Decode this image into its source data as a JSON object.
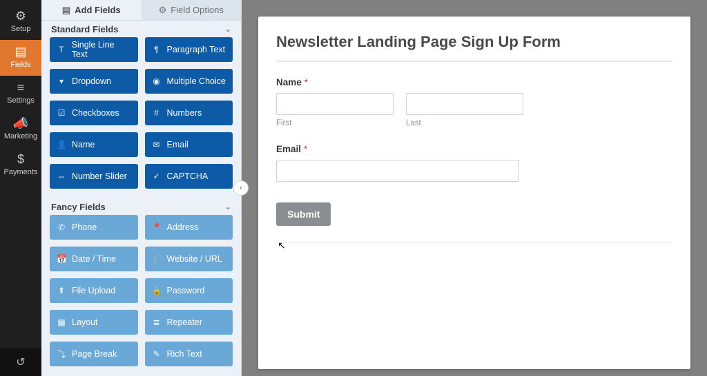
{
  "nav": {
    "items": [
      {
        "label": "Setup",
        "icon": "⚙"
      },
      {
        "label": "Fields",
        "icon": "▤"
      },
      {
        "label": "Settings",
        "icon": "≡"
      },
      {
        "label": "Marketing",
        "icon": "📣"
      },
      {
        "label": "Payments",
        "icon": "$"
      }
    ],
    "history_icon": "↺"
  },
  "panel": {
    "tabs": {
      "add": {
        "label": "Add Fields",
        "icon": "▤"
      },
      "options": {
        "label": "Field Options",
        "icon": "⚙"
      }
    },
    "groups": {
      "standard": {
        "title": "Standard Fields",
        "fields": [
          {
            "label": "Single Line Text",
            "icon": "T"
          },
          {
            "label": "Paragraph Text",
            "icon": "¶"
          },
          {
            "label": "Dropdown",
            "icon": "▾"
          },
          {
            "label": "Multiple Choice",
            "icon": "◉"
          },
          {
            "label": "Checkboxes",
            "icon": "☑"
          },
          {
            "label": "Numbers",
            "icon": "#"
          },
          {
            "label": "Name",
            "icon": "👤"
          },
          {
            "label": "Email",
            "icon": "✉"
          },
          {
            "label": "Number Slider",
            "icon": "⇔"
          },
          {
            "label": "CAPTCHA",
            "icon": "✓"
          }
        ]
      },
      "fancy": {
        "title": "Fancy Fields",
        "fields": [
          {
            "label": "Phone",
            "icon": "✆"
          },
          {
            "label": "Address",
            "icon": "📍"
          },
          {
            "label": "Date / Time",
            "icon": "📅"
          },
          {
            "label": "Website / URL",
            "icon": "🔗"
          },
          {
            "label": "File Upload",
            "icon": "⬆"
          },
          {
            "label": "Password",
            "icon": "🔒"
          },
          {
            "label": "Layout",
            "icon": "▦"
          },
          {
            "label": "Repeater",
            "icon": "≣"
          },
          {
            "label": "Page Break",
            "icon": "⤵"
          },
          {
            "label": "Rich Text",
            "icon": "✎"
          }
        ]
      }
    },
    "chevron": "⌄",
    "collapse_icon": "‹"
  },
  "form": {
    "title": "Newsletter Landing Page Sign Up Form",
    "name_label": "Name",
    "required_mark": "*",
    "first_sublabel": "First",
    "last_sublabel": "Last",
    "email_label": "Email",
    "submit_label": "Submit"
  }
}
